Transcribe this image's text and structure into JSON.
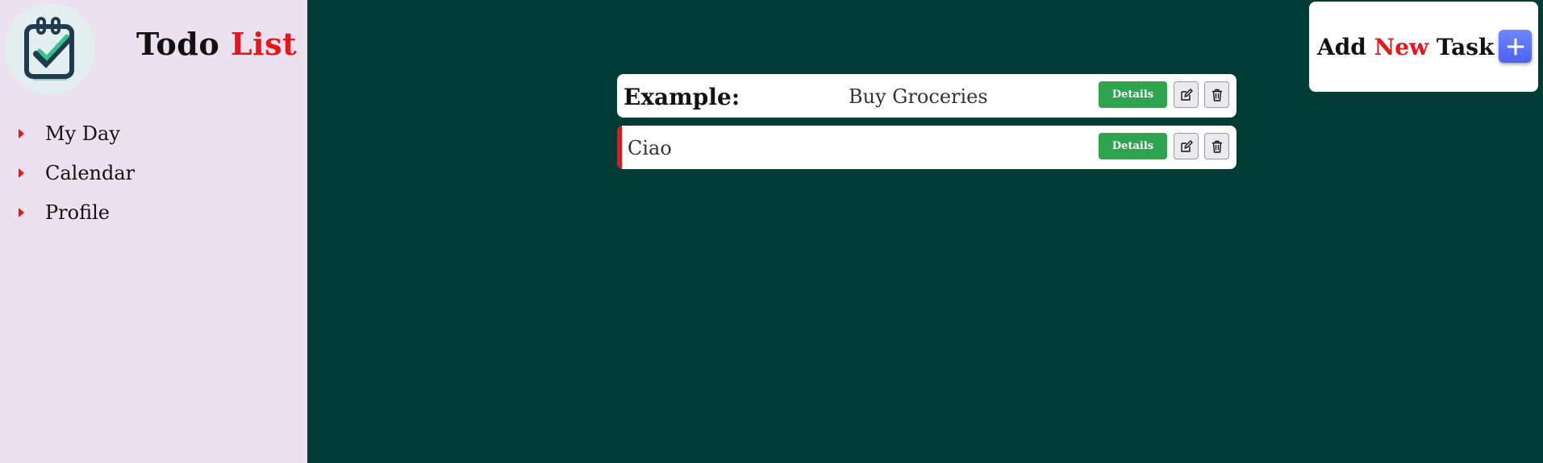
{
  "sidebar": {
    "brand": {
      "word1": "Todo",
      "word2": "List"
    },
    "items": [
      {
        "label": "My Day"
      },
      {
        "label": "Calendar"
      },
      {
        "label": "Profile"
      }
    ]
  },
  "add_task": {
    "word1": "Add",
    "word2": "New",
    "word3": "Task",
    "button_icon": "plus-icon"
  },
  "tasks": {
    "example": {
      "label": "Example:",
      "text": "Buy Groceries",
      "details_label": "Details"
    },
    "items": [
      {
        "text": "Ciao",
        "details_label": "Details"
      }
    ]
  },
  "colors": {
    "main_bg": "#003b36",
    "sidebar_bg": "#ebe1ef",
    "accent_red": "#e8151b",
    "details_green": "#2ea44f",
    "add_blue": "#5a73f8"
  }
}
